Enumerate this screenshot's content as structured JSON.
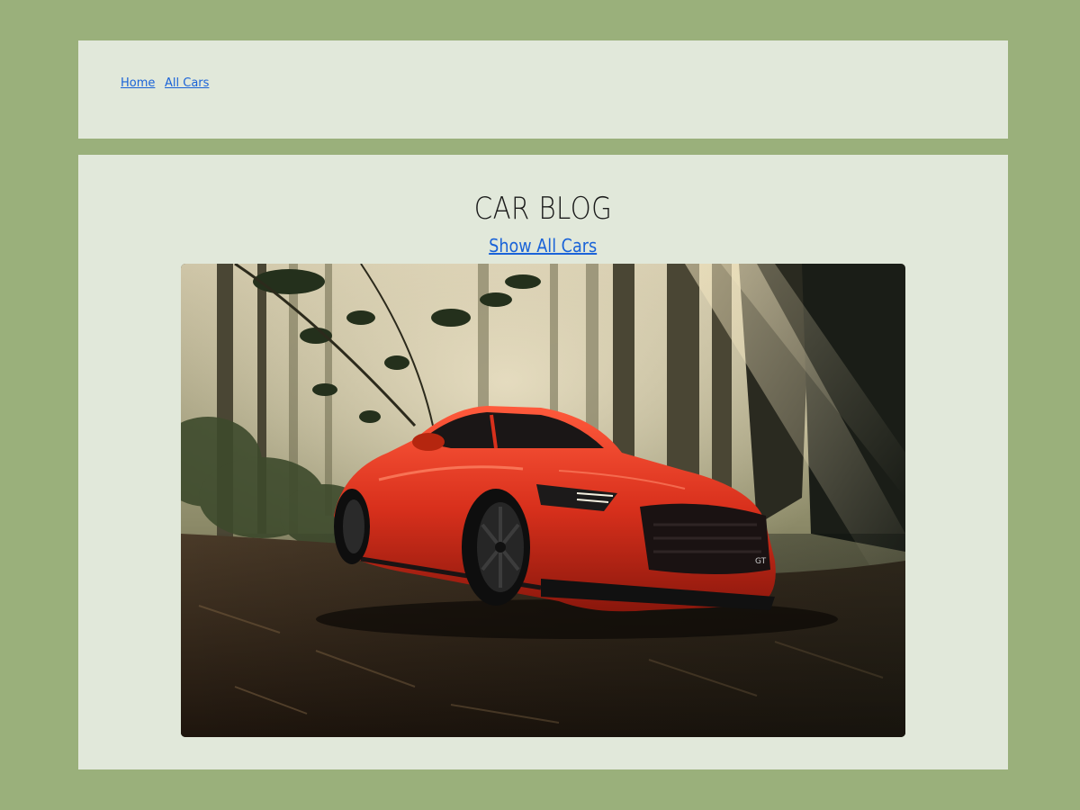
{
  "nav": {
    "home_label": "Home",
    "all_cars_label": "All Cars"
  },
  "main": {
    "title": "CAR BLOG",
    "show_all_label": "Show All Cars"
  },
  "hero_image": {
    "subject": "red sports car in a misty forest",
    "icon": "car-photo",
    "colors": {
      "car_body": "#d8301c",
      "forest_light": "#d9cfb2",
      "ground": "#3a2a1c"
    }
  },
  "colors": {
    "page_background": "#9ab07b",
    "panel_background": "#e1e8da",
    "link": "#1a63d8",
    "title": "#1a1a1a"
  }
}
